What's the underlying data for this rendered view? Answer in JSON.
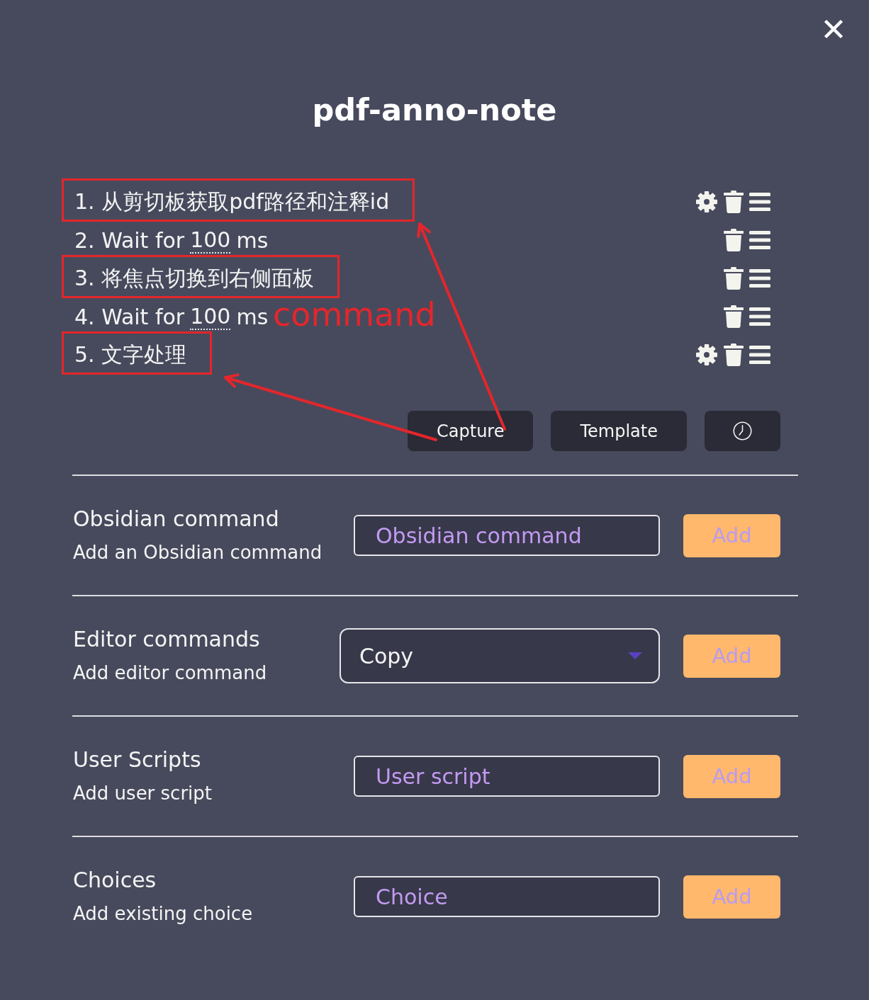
{
  "title": "pdf-anno-note",
  "steps": [
    {
      "kind": "command",
      "label": "1. 从剪切板获取pdf路径和注释id",
      "has_settings": true,
      "highlighted": true
    },
    {
      "kind": "wait",
      "label": "2. Wait for",
      "value": "100",
      "unit": "ms",
      "has_settings": false,
      "highlighted": false
    },
    {
      "kind": "command",
      "label": "3. 将焦点切换到右侧面板",
      "has_settings": false,
      "highlighted": true
    },
    {
      "kind": "wait",
      "label": "4. Wait for",
      "value": "100",
      "unit": "ms",
      "has_settings": false,
      "highlighted": false
    },
    {
      "kind": "command",
      "label": "5. 文字处理",
      "has_settings": true,
      "highlighted": true
    }
  ],
  "action_buttons": [
    {
      "kind": "text",
      "label": "Capture"
    },
    {
      "kind": "text",
      "label": "Template"
    },
    {
      "kind": "clock"
    }
  ],
  "sections": [
    {
      "title": "Obsidian command",
      "description": "Add an Obsidian command",
      "control": {
        "kind": "input",
        "placeholder": "Obsidian command"
      },
      "button": "Add"
    },
    {
      "title": "Editor commands",
      "description": "Add editor command",
      "control": {
        "kind": "select",
        "value": "Copy"
      },
      "button": "Add"
    },
    {
      "title": "User Scripts",
      "description": "Add user script",
      "control": {
        "kind": "input",
        "placeholder": "User script"
      },
      "button": "Add"
    },
    {
      "title": "Choices",
      "description": "Add existing choice",
      "control": {
        "kind": "input",
        "placeholder": "Choice"
      },
      "button": "Add"
    }
  ],
  "annotation": {
    "label": "command"
  }
}
